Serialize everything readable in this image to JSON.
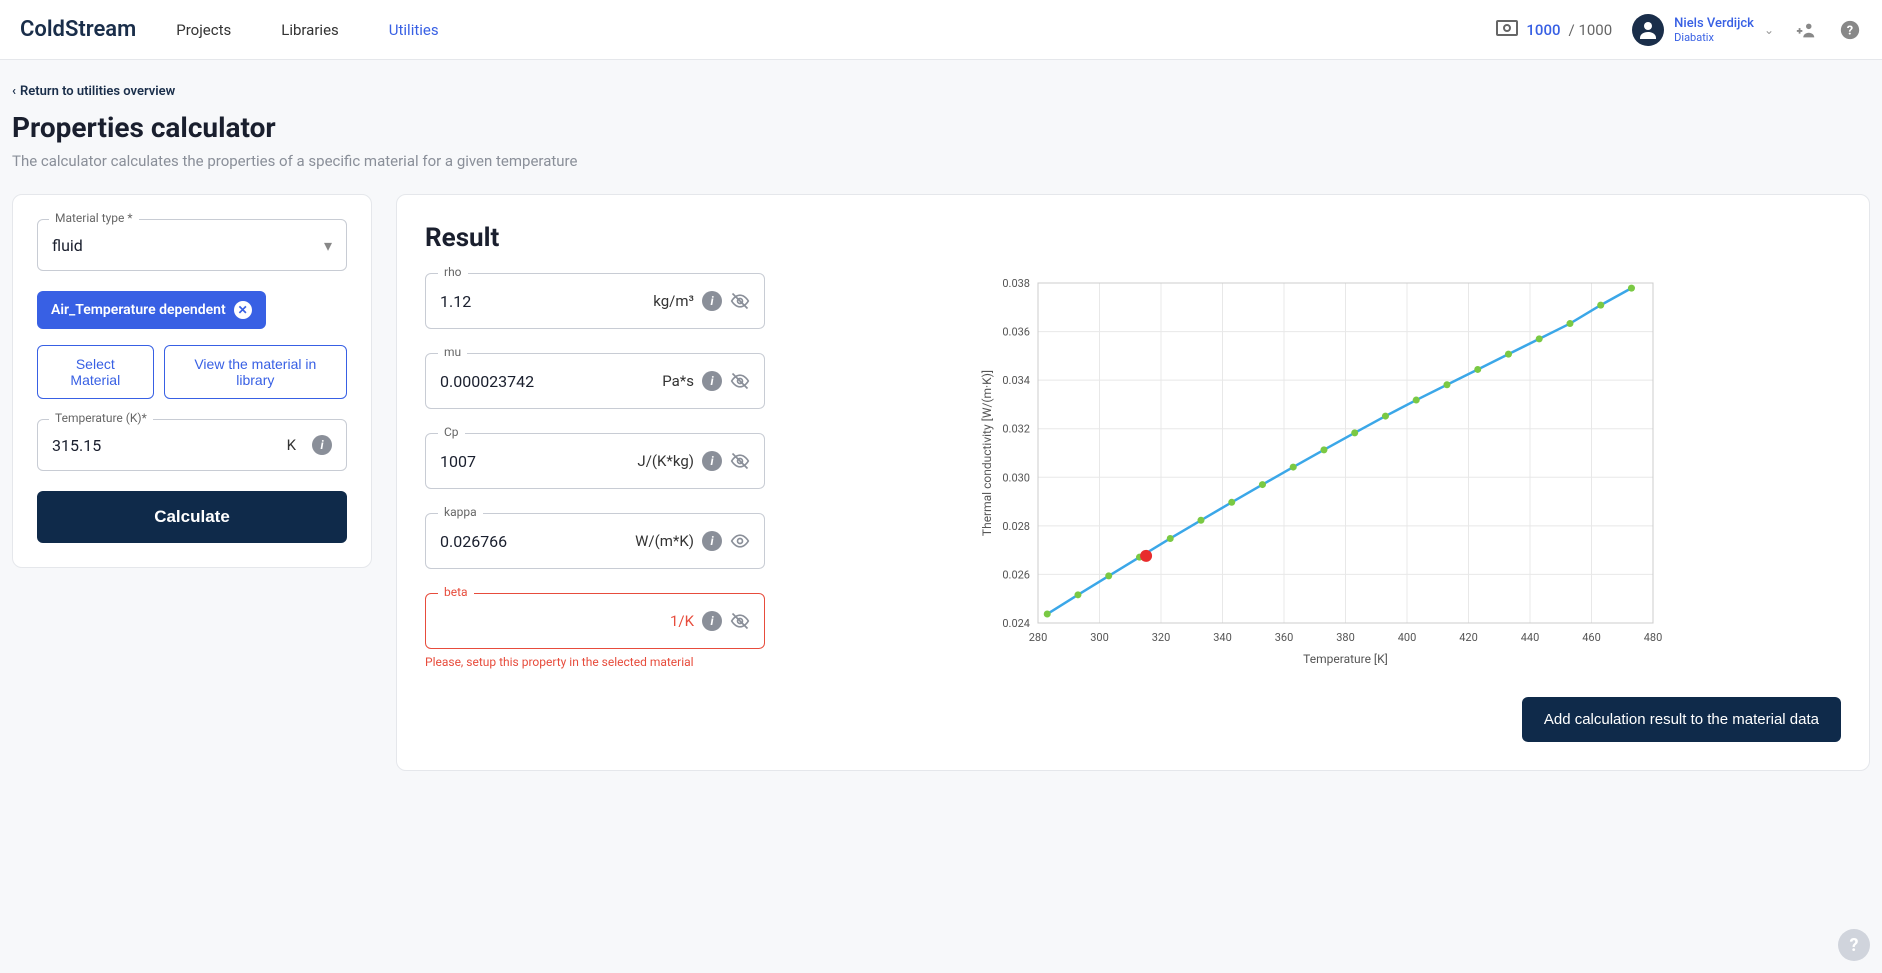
{
  "header": {
    "logo": "ColdStream",
    "nav": {
      "projects": "Projects",
      "libraries": "Libraries",
      "utilities": "Utilities"
    },
    "credits_used": "1000",
    "credits_total": "1000",
    "user_name": "Niels Verdijck",
    "user_org": "Diabatix"
  },
  "page": {
    "back": "Return to utilities overview",
    "title": "Properties calculator",
    "subtitle": "The calculator calculates the properties of a specific material for a given temperature"
  },
  "form": {
    "material_type_label": "Material type *",
    "material_type_value": "fluid",
    "material_chip": "Air_Temperature dependent",
    "select_material_btn": "Select Material",
    "view_library_btn": "View the material in library",
    "temperature_label": "Temperature (K)*",
    "temperature_value": "315.15",
    "temperature_unit": "K",
    "calculate_btn": "Calculate"
  },
  "result": {
    "title": "Result",
    "rho": {
      "label": "rho",
      "value": "1.12",
      "unit": "kg/m³"
    },
    "mu": {
      "label": "mu",
      "value": "0.000023742",
      "unit": "Pa*s"
    },
    "cp": {
      "label": "Cp",
      "value": "1007",
      "unit": "J/(K*kg)"
    },
    "kappa": {
      "label": "kappa",
      "value": "0.026766",
      "unit": "W/(m*K)"
    },
    "beta": {
      "label": "beta",
      "value": "",
      "unit": "1/K"
    },
    "beta_error": "Please, setup this property in the selected material",
    "add_btn": "Add calculation result to the material data"
  },
  "chart_data": {
    "type": "line",
    "xlabel": "Temperature [K]",
    "ylabel": "Thermal conductivity [W/(m·K)]",
    "xlim": [
      280,
      480
    ],
    "ylim": [
      0.024,
      0.038
    ],
    "x_ticks": [
      280,
      300,
      320,
      340,
      360,
      380,
      400,
      420,
      440,
      460,
      480
    ],
    "y_ticks": [
      0.024,
      0.026,
      0.028,
      0.03,
      0.032,
      0.034,
      0.036,
      0.038
    ],
    "series": [
      {
        "name": "kappa",
        "color": "#3ba7e8",
        "marker_color": "#7ac943",
        "x": [
          283,
          293,
          303,
          313,
          323,
          333,
          343,
          353,
          363,
          373,
          383,
          393,
          403,
          413,
          423,
          433,
          443,
          453,
          463,
          473
        ],
        "y": [
          0.02437,
          0.02516,
          0.02594,
          0.02671,
          0.02748,
          0.02823,
          0.02897,
          0.0297,
          0.03042,
          0.03113,
          0.03183,
          0.03252,
          0.03318,
          0.03381,
          0.03444,
          0.03507,
          0.0357,
          0.03633,
          0.03709,
          0.03779
        ]
      }
    ],
    "highlight": {
      "x": 315.15,
      "y": 0.026766,
      "color": "#e82c2c"
    }
  }
}
